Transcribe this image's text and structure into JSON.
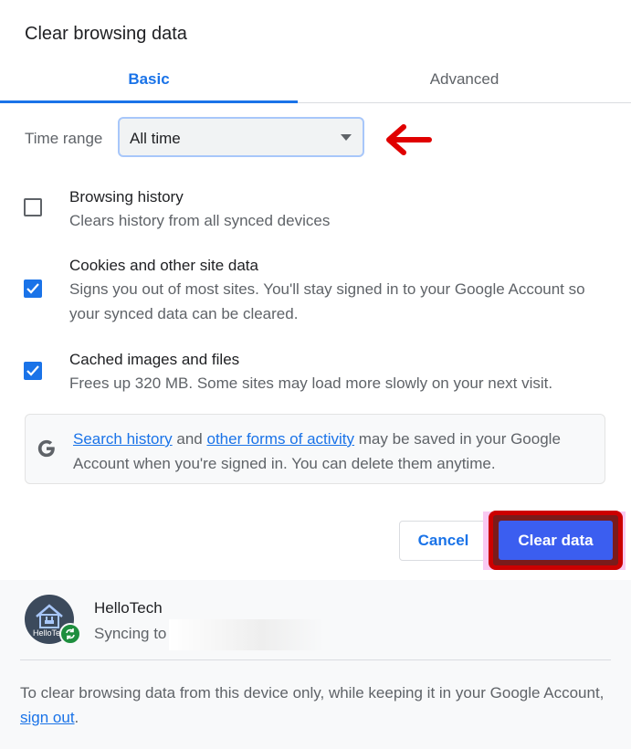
{
  "dialog": {
    "title": "Clear browsing data"
  },
  "tabs": [
    {
      "label": "Basic",
      "selected": true
    },
    {
      "label": "Advanced",
      "selected": false
    }
  ],
  "time_range": {
    "label": "Time range",
    "selected_value": "All time"
  },
  "options": [
    {
      "title": "Browsing history",
      "description": "Clears history from all synced devices",
      "checked": false
    },
    {
      "title": "Cookies and other site data",
      "description": "Signs you out of most sites. You'll stay signed in to your Google Account so your synced data can be cleared.",
      "checked": true
    },
    {
      "title": "Cached images and files",
      "description": "Frees up 320 MB. Some sites may load more slowly on your next visit.",
      "checked": true
    }
  ],
  "info": {
    "link1": "Search history",
    "mid1": " and ",
    "link2": "other forms of activity",
    "rest": " may be saved in your Google Account when you're signed in. You can delete them anytime."
  },
  "buttons": {
    "cancel": "Cancel",
    "clear": "Clear data"
  },
  "account": {
    "name": "HelloTech",
    "sync_label": "Syncing to",
    "avatar_text": "HelloTe"
  },
  "footer": {
    "text": "To clear browsing data from this device only, while keeping it in your Google Account, ",
    "link": "sign out",
    "end": "."
  },
  "colors": {
    "accent": "#1a73e8",
    "clear_button": "#3b5ef0",
    "annotation_red": "#cc0000",
    "sync_badge": "#1e8e3e"
  },
  "icons": [
    "chevron-down-icon",
    "checkbox-icon",
    "google-g-icon",
    "sync-icon",
    "annotation-arrow-icon"
  ]
}
